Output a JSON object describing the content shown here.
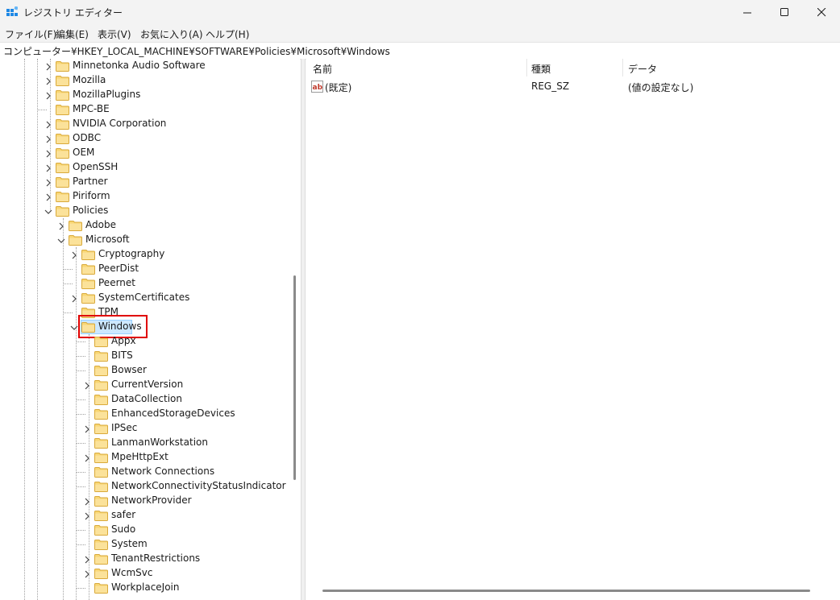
{
  "window": {
    "title": "レジストリ エディター"
  },
  "menu": [
    "ファイル(F)",
    "編集(E)",
    "表示(V)",
    "お気に入り(A)",
    "ヘルプ(H)"
  ],
  "address": "コンピューター¥HKEY_LOCAL_MACHINE¥SOFTWARE¥Policies¥Microsoft¥Windows",
  "tree": [
    {
      "label": "Minnetonka Audio Software",
      "level": 0,
      "expander": "collapsed"
    },
    {
      "label": "Mozilla",
      "level": 0,
      "expander": "collapsed"
    },
    {
      "label": "MozillaPlugins",
      "level": 0,
      "expander": "collapsed"
    },
    {
      "label": "MPC-BE",
      "level": 0,
      "expander": "none"
    },
    {
      "label": "NVIDIA Corporation",
      "level": 0,
      "expander": "collapsed"
    },
    {
      "label": "ODBC",
      "level": 0,
      "expander": "collapsed"
    },
    {
      "label": "OEM",
      "level": 0,
      "expander": "collapsed"
    },
    {
      "label": "OpenSSH",
      "level": 0,
      "expander": "collapsed"
    },
    {
      "label": "Partner",
      "level": 0,
      "expander": "collapsed"
    },
    {
      "label": "Piriform",
      "level": 0,
      "expander": "collapsed"
    },
    {
      "label": "Policies",
      "level": 0,
      "expander": "expanded"
    },
    {
      "label": "Adobe",
      "level": 1,
      "expander": "collapsed"
    },
    {
      "label": "Microsoft",
      "level": 1,
      "expander": "expanded"
    },
    {
      "label": "Cryptography",
      "level": 2,
      "expander": "collapsed"
    },
    {
      "label": "PeerDist",
      "level": 2,
      "expander": "none"
    },
    {
      "label": "Peernet",
      "level": 2,
      "expander": "none"
    },
    {
      "label": "SystemCertificates",
      "level": 2,
      "expander": "collapsed"
    },
    {
      "label": "TPM",
      "level": 2,
      "expander": "none"
    },
    {
      "label": "Windows",
      "level": 2,
      "expander": "expanded",
      "selected": true
    },
    {
      "label": "Appx",
      "level": 3,
      "expander": "none"
    },
    {
      "label": "BITS",
      "level": 3,
      "expander": "none"
    },
    {
      "label": "Bowser",
      "level": 3,
      "expander": "none"
    },
    {
      "label": "CurrentVersion",
      "level": 3,
      "expander": "collapsed"
    },
    {
      "label": "DataCollection",
      "level": 3,
      "expander": "none"
    },
    {
      "label": "EnhancedStorageDevices",
      "level": 3,
      "expander": "none"
    },
    {
      "label": "IPSec",
      "level": 3,
      "expander": "collapsed"
    },
    {
      "label": "LanmanWorkstation",
      "level": 3,
      "expander": "none"
    },
    {
      "label": "MpeHttpExt",
      "level": 3,
      "expander": "collapsed"
    },
    {
      "label": "Network Connections",
      "level": 3,
      "expander": "none"
    },
    {
      "label": "NetworkConnectivityStatusIndicator",
      "level": 3,
      "expander": "none"
    },
    {
      "label": "NetworkProvider",
      "level": 3,
      "expander": "collapsed"
    },
    {
      "label": "safer",
      "level": 3,
      "expander": "collapsed"
    },
    {
      "label": "Sudo",
      "level": 3,
      "expander": "none"
    },
    {
      "label": "System",
      "level": 3,
      "expander": "none"
    },
    {
      "label": "TenantRestrictions",
      "level": 3,
      "expander": "collapsed"
    },
    {
      "label": "WcmSvc",
      "level": 3,
      "expander": "collapsed"
    },
    {
      "label": "WorkplaceJoin",
      "level": 3,
      "expander": "none"
    }
  ],
  "columns": {
    "name": "名前",
    "type": "種類",
    "data": "データ"
  },
  "values": [
    {
      "icon": "string-value-icon",
      "name": "(既定)",
      "type": "REG_SZ",
      "data": "(値の設定なし)"
    }
  ],
  "colors": {
    "highlight": "#e00000",
    "selection": "#cce8ff",
    "folder": "#f8d775"
  }
}
